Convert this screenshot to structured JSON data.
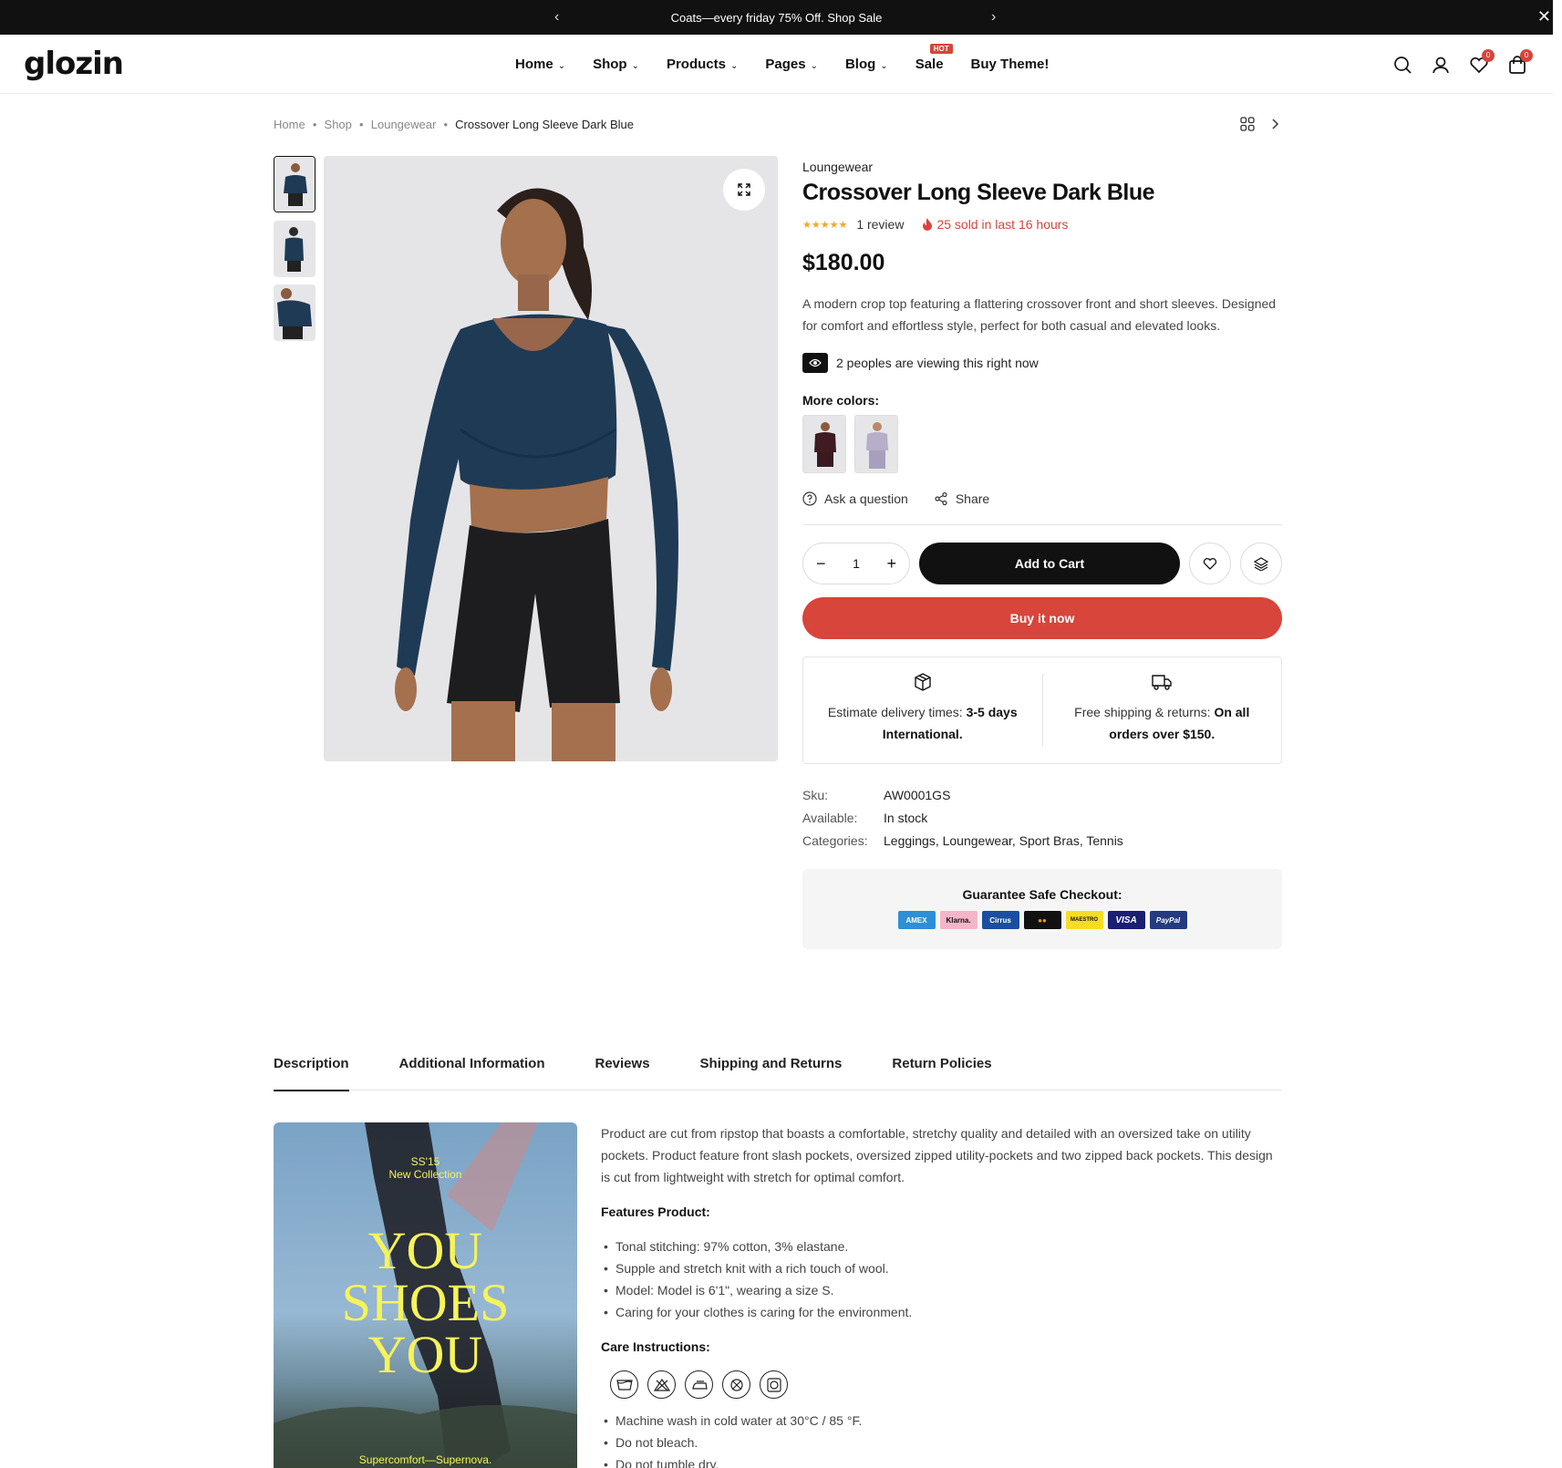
{
  "announcement": {
    "text": "Coats—every friday 75% Off. Shop Sale",
    "prev": "‹",
    "next": "›",
    "close": "✕"
  },
  "header": {
    "logo": "glozin",
    "nav": [
      {
        "label": "Home",
        "chevron": "⌄"
      },
      {
        "label": "Shop",
        "chevron": "⌄"
      },
      {
        "label": "Products",
        "chevron": "⌄"
      },
      {
        "label": "Pages",
        "chevron": "⌄"
      },
      {
        "label": "Blog",
        "chevron": "⌄"
      },
      {
        "label": "Sale",
        "badge": "HOT"
      },
      {
        "label": "Buy Theme!"
      }
    ],
    "wishlist_count": "0",
    "cart_count": "0"
  },
  "breadcrumb": {
    "items": [
      "Home",
      "Shop",
      "Loungewear"
    ],
    "current": "Crossover Long Sleeve Dark Blue"
  },
  "product": {
    "category": "Loungewear",
    "title": "Crossover Long Sleeve Dark Blue",
    "stars": "★★★★★",
    "reviews": "1 review",
    "sold": "25 sold in last 16 hours",
    "price": "$180.00",
    "description": "A modern crop top featuring a flattering crossover front and short sleeves. Designed for comfort and effortless style, perfect for both casual and elevated looks.",
    "viewing": "2 peoples are viewing this right now",
    "more_colors_label": "More colors:",
    "ask_question": "Ask a question",
    "share": "Share",
    "quantity": "1",
    "add_to_cart": "Add to Cart",
    "buy_now": "Buy it now",
    "delivery": {
      "prefix": "Estimate delivery times: ",
      "bold": "3-5 days International."
    },
    "shipping": {
      "prefix": "Free shipping & returns: ",
      "bold": "On all orders over $150."
    },
    "meta": {
      "sku_label": "Sku:",
      "sku": "AW0001GS",
      "available_label": "Available:",
      "available": "In stock",
      "categories_label": "Categories:",
      "categories": "Leggings, Loungewear, Sport Bras, Tennis"
    },
    "guarantee": "Guarantee Safe Checkout:",
    "payment_cards": [
      "AMEX",
      "Klarna.",
      "Cirrus",
      "●●",
      "MAESTRO",
      "VISA",
      "PayPal"
    ]
  },
  "tabs": [
    "Description",
    "Additional Information",
    "Reviews",
    "Shipping and Returns",
    "Return Policies"
  ],
  "promo": {
    "ss": "SS'15",
    "collection": "New Collection",
    "line1": "YOU",
    "line2": "SHOES",
    "line3": "YOU",
    "footer": "Supercomfort—Supernova."
  },
  "description_tab": {
    "intro": "Product are cut from ripstop that boasts a comfortable, stretchy quality and detailed with an oversized take on utility pockets. Product feature front slash pockets, oversized zipped utility-pockets and two zipped back pockets. This design is cut from lightweight with stretch for optimal comfort.",
    "features_title": "Features Product:",
    "features": [
      "Tonal stitching: 97% cotton, 3% elastane.",
      "Supple and stretch knit with a rich touch of wool.",
      "Model: Model is 6'1\", wearing a size S.",
      "Caring for your clothes is caring for the environment."
    ],
    "care_title": "Care Instructions:",
    "care": [
      "Machine wash in cold water at 30°C / 85 °F.",
      "Do not bleach.",
      "Do not tumble dry."
    ]
  }
}
